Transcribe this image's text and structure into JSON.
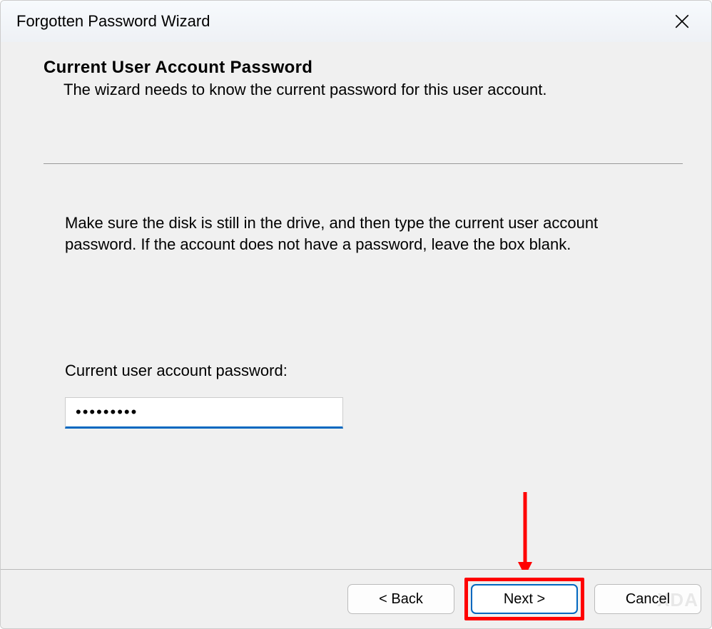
{
  "titlebar": {
    "title": "Forgotten Password Wizard"
  },
  "header": {
    "heading": "Current User Account Password",
    "subheading": "The wizard needs to know the current password for this user account."
  },
  "content": {
    "instruction": "Make sure the disk is still in the drive, and then type the current user account password. If the account does not have a password, leave the box blank.",
    "password_label": "Current user account password:",
    "password_value": "•••••••••"
  },
  "footer": {
    "back_label": "< Back",
    "next_label": "Next >",
    "cancel_label": "Cancel"
  }
}
